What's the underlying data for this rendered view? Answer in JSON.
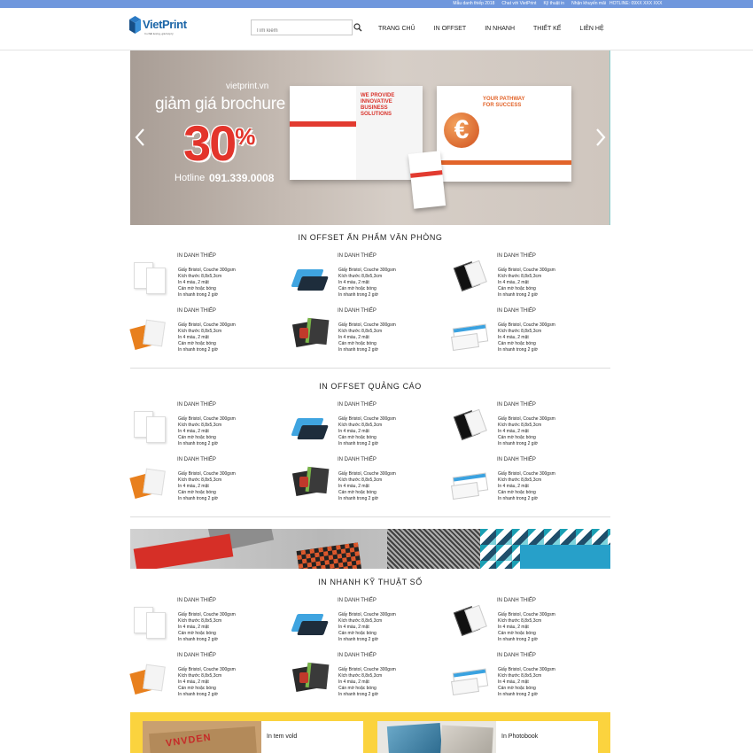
{
  "topbar": {
    "links": [
      "Mẫu danh thiếp 2018",
      "Chat với VietPrint",
      "Kỹ thuật in",
      "Nhận khuyến mãi"
    ],
    "hotline": "HOTLINE: 09XX XXX XXX"
  },
  "header": {
    "logo_text": "VietPrint",
    "logo_tagline": "In chất lượng, giá hợp lý",
    "search_placeholder": "Tìm kiếm",
    "nav": [
      "TRANG CHỦ",
      "IN OFFSET",
      "IN NHANH",
      "THIẾT KẾ",
      "LIÊN HỆ"
    ]
  },
  "banner": {
    "site": "vietprint.vn",
    "title": "giảm giá brochure",
    "percent": "30",
    "percent_sign": "%",
    "hotline_label": "Hotline",
    "hotline_number": "091.339.0008",
    "brochure_left_title": "WE PROVIDE INNOVATIVE BUSINESS SOLUTIONS",
    "brochure_right_title": "YOUR PATHWAY FOR SUCCESS"
  },
  "sections": [
    {
      "title": "IN OFFSET ẤN PHẨM VĂN PHÒNG",
      "items": [
        {
          "name": "IN DANH THIẾP",
          "thumb": "letterhead",
          "specs": [
            "Giấy Bristol, Couche 300gsm",
            "Kích thước 8,8x5,3cm",
            "In 4 màu, 2 mặt",
            "Cán mờ hoặc bóng",
            "In nhanh trong 2 giờ"
          ]
        },
        {
          "name": "IN DANH THIẾP",
          "thumb": "blue-cards",
          "specs": [
            "Giấy Bristol, Couche 300gsm",
            "Kích thước 8,8x5,3cm",
            "In 4 màu, 2 mặt",
            "Cán mờ hoặc bóng",
            "In nhanh trong 2 giờ"
          ]
        },
        {
          "name": "IN DANH THIẾP",
          "thumb": "black-folder",
          "specs": [
            "Giấy Bristol, Couche 300gsm",
            "Kích thước 8,8x5,3cm",
            "In 4 màu, 2 mặt",
            "Cán mờ hoặc bóng",
            "In nhanh trong 2 giờ"
          ]
        },
        {
          "name": "IN DANH THIẾP",
          "thumb": "orange-folder",
          "specs": [
            "Giấy Bristol, Couche 300gsm",
            "Kích thước 8,8x5,3cm",
            "In 4 màu, 2 mặt",
            "Cán mờ hoặc bóng",
            "In nhanh trong 2 giờ"
          ]
        },
        {
          "name": "IN DANH THIẾP",
          "thumb": "dark-cards",
          "specs": [
            "Giấy Bristol, Couche 300gsm",
            "Kích thước 8,8x5,3cm",
            "In 4 màu, 2 mặt",
            "Cán mờ hoặc bóng",
            "In nhanh trong 2 giờ"
          ]
        },
        {
          "name": "IN DANH THIẾP",
          "thumb": "envelopes",
          "specs": [
            "Giấy Bristol, Couche 300gsm",
            "Kích thước 8,8x5,3cm",
            "In 4 màu, 2 mặt",
            "Cán mờ hoặc bóng",
            "In nhanh trong 2 giờ"
          ]
        }
      ]
    },
    {
      "title": "IN OFFSET QUẢNG CÁO",
      "items": [
        {
          "name": "IN DANH THIẾP",
          "thumb": "letterhead",
          "specs": [
            "Giấy Bristol, Couche 300gsm",
            "Kích thước 8,8x5,3cm",
            "In 4 màu, 2 mặt",
            "Cán mờ hoặc bóng",
            "In nhanh trong 2 giờ"
          ]
        },
        {
          "name": "IN DANH THIẾP",
          "thumb": "blue-cards",
          "specs": [
            "Giấy Bristol, Couche 300gsm",
            "Kích thước 8,8x5,3cm",
            "In 4 màu, 2 mặt",
            "Cán mờ hoặc bóng",
            "In nhanh trong 2 giờ"
          ]
        },
        {
          "name": "IN DANH THIẾP",
          "thumb": "black-folder",
          "specs": [
            "Giấy Bristol, Couche 300gsm",
            "Kích thước 8,8x5,3cm",
            "In 4 màu, 2 mặt",
            "Cán mờ hoặc bóng",
            "In nhanh trong 2 giờ"
          ]
        },
        {
          "name": "IN DANH THIẾP",
          "thumb": "orange-folder",
          "specs": [
            "Giấy Bristol, Couche 300gsm",
            "Kích thước 8,8x5,3cm",
            "In 4 màu, 2 mặt",
            "Cán mờ hoặc bóng",
            "In nhanh trong 2 giờ"
          ]
        },
        {
          "name": "IN DANH THIẾP",
          "thumb": "dark-cards",
          "specs": [
            "Giấy Bristol, Couche 300gsm",
            "Kích thước 8,8x5,3cm",
            "In 4 màu, 2 mặt",
            "Cán mờ hoặc bóng",
            "In nhanh trong 2 giờ"
          ]
        },
        {
          "name": "IN DANH THIẾP",
          "thumb": "envelopes",
          "specs": [
            "Giấy Bristol, Couche 300gsm",
            "Kích thước 8,8x5,3cm",
            "In 4 màu, 2 mặt",
            "Cán mờ hoặc bóng",
            "In nhanh trong 2 giờ"
          ]
        }
      ]
    },
    {
      "title": "IN NHANH KỸ THUẬT SỐ",
      "items": [
        {
          "name": "IN DANH THIẾP",
          "thumb": "letterhead",
          "specs": [
            "Giấy Bristol, Couche 300gsm",
            "Kích thước 8,8x5,3cm",
            "In 4 màu, 2 mặt",
            "Cán mờ hoặc bóng",
            "In nhanh trong 2 giờ"
          ]
        },
        {
          "name": "IN DANH THIẾP",
          "thumb": "blue-cards",
          "specs": [
            "Giấy Bristol, Couche 300gsm",
            "Kích thước 8,8x5,3cm",
            "In 4 màu, 2 mặt",
            "Cán mờ hoặc bóng",
            "In nhanh trong 2 giờ"
          ]
        },
        {
          "name": "IN DANH THIẾP",
          "thumb": "black-folder",
          "specs": [
            "Giấy Bristol, Couche 300gsm",
            "Kích thước 8,8x5,3cm",
            "In 4 màu, 2 mặt",
            "Cán mờ hoặc bóng",
            "In nhanh trong 2 giờ"
          ]
        },
        {
          "name": "IN DANH THIẾP",
          "thumb": "orange-folder",
          "specs": [
            "Giấy Bristol, Couche 300gsm",
            "Kích thước 8,8x5,3cm",
            "In 4 màu, 2 mặt",
            "Cán mờ hoặc bóng",
            "In nhanh trong 2 giờ"
          ]
        },
        {
          "name": "IN DANH THIẾP",
          "thumb": "dark-cards",
          "specs": [
            "Giấy Bristol, Couche 300gsm",
            "Kích thước 8,8x5,3cm",
            "In 4 màu, 2 mặt",
            "Cán mờ hoặc bóng",
            "In nhanh trong 2 giờ"
          ]
        },
        {
          "name": "IN DANH THIẾP",
          "thumb": "envelopes",
          "specs": [
            "Giấy Bristol, Couche 300gsm",
            "Kích thước 8,8x5,3cm",
            "In 4 màu, 2 mặt",
            "Cán mờ hoặc bóng",
            "In nhanh trong 2 giờ"
          ]
        }
      ]
    }
  ],
  "promos": [
    {
      "label": "In tem vold",
      "img_text": "VNVDEN"
    },
    {
      "label": "In Photobook"
    }
  ],
  "colors": {
    "topbar": "#6f97dd",
    "brand_blue": "#1c66a8",
    "banner_red": "#e3342b",
    "promo_yellow": "#fbd33e"
  },
  "icons": {
    "search": "magnifier-icon",
    "prev": "chevron-left-icon",
    "next": "chevron-right-icon"
  }
}
